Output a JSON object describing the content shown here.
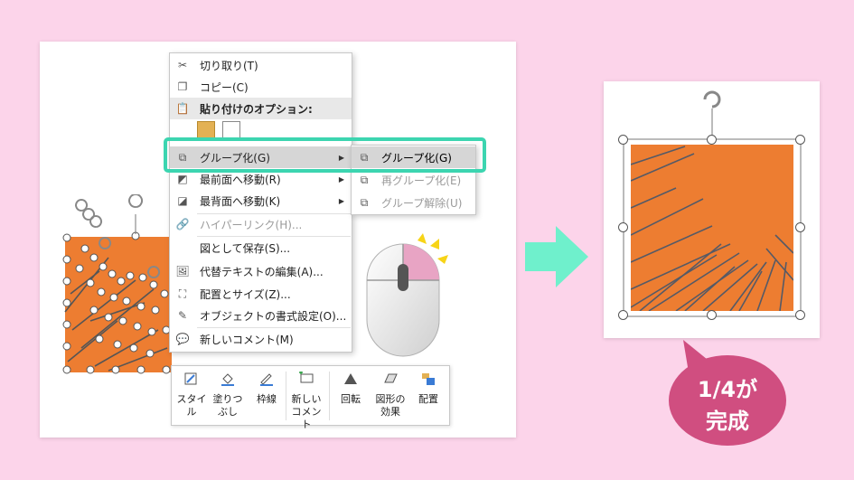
{
  "context_menu": {
    "items": [
      {
        "label": "切り取り(T)",
        "icon": "scissors-icon"
      },
      {
        "label": "コピー(C)",
        "icon": "copy-icon"
      },
      {
        "label": "貼り付けのオプション:",
        "icon": "paste-icon"
      },
      {
        "label": "グループ化(G)",
        "icon": "group-icon",
        "submenu": true
      },
      {
        "label": "最前面へ移動(R)",
        "icon": "bring-front-icon",
        "submenu": true
      },
      {
        "label": "最背面へ移動(K)",
        "icon": "send-back-icon",
        "submenu": true
      },
      {
        "label": "ハイパーリンク(H)...",
        "icon": "link-icon"
      },
      {
        "label": "図として保存(S)...",
        "icon": ""
      },
      {
        "label": "代替テキストの編集(A)...",
        "icon": "picture-icon"
      },
      {
        "label": "配置とサイズ(Z)...",
        "icon": "size-icon"
      },
      {
        "label": "オブジェクトの書式設定(O)...",
        "icon": "format-icon"
      },
      {
        "label": "新しいコメント(M)",
        "icon": "comment-icon"
      }
    ]
  },
  "submenu": {
    "items": [
      {
        "label": "グループ化(G)",
        "icon": "group-icon"
      },
      {
        "label": "再グループ化(E)",
        "icon": "regroup-icon"
      },
      {
        "label": "グループ解除(U)",
        "icon": "ungroup-icon"
      }
    ]
  },
  "toolbar": {
    "style": "スタイル",
    "fill_1": "塗りつ",
    "fill_2": "ぶし",
    "outline": "枠線",
    "comment_1": "新しい",
    "comment_2": "コメント",
    "rotate": "回転",
    "effects_1": "図形の",
    "effects_2": "効果",
    "arrange": "配置"
  },
  "callout": {
    "line1": "1/4が",
    "line2": "完成"
  },
  "colors": {
    "background": "#fcd4ea",
    "shape": "#ed7d31",
    "highlight": "#3cd5b0",
    "arrow": "#6ff0cc",
    "bubble": "#d04e80"
  }
}
